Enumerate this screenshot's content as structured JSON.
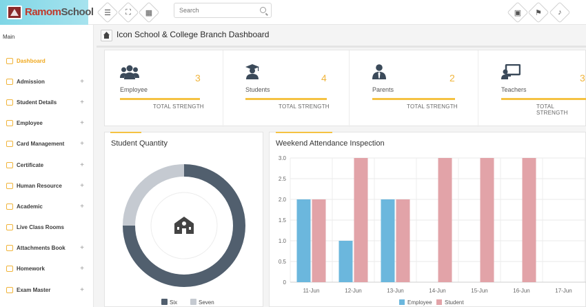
{
  "app": {
    "logo_part1": "Ramom",
    "logo_part2": "School"
  },
  "topbar": {
    "menu_icon": "hamburger-icon",
    "fullscreen_icon": "fullscreen-icon",
    "apps_icon": "grid-icon",
    "search": {
      "placeholder": "Search"
    },
    "right_icons": [
      "calendar-icon",
      "flag-icon",
      "bell-icon"
    ]
  },
  "sidebar": {
    "section_title": "Main",
    "items": [
      {
        "label": "Dashboard",
        "active": true,
        "expandable": false
      },
      {
        "label": "Admission",
        "expandable": true
      },
      {
        "label": "Student Details",
        "expandable": true
      },
      {
        "label": "Employee",
        "expandable": true
      },
      {
        "label": "Card Management",
        "expandable": true
      },
      {
        "label": "Certificate",
        "expandable": true
      },
      {
        "label": "Human Resource",
        "expandable": true
      },
      {
        "label": "Academic",
        "expandable": true
      },
      {
        "label": "Live Class Rooms",
        "expandable": false
      },
      {
        "label": "Attachments Book",
        "expandable": true
      },
      {
        "label": "Homework",
        "expandable": true
      },
      {
        "label": "Exam Master",
        "expandable": true
      }
    ],
    "plus": "+"
  },
  "page": {
    "title": "Icon School & College Branch Dashboard"
  },
  "stats": [
    {
      "label": "Employee",
      "count": "3",
      "sub": "TOTAL STRENGTH",
      "icon": "users-icon"
    },
    {
      "label": "Students",
      "count": "4",
      "sub": "TOTAL STRENGTH",
      "icon": "graduate-icon"
    },
    {
      "label": "Parents",
      "count": "2",
      "sub": "TOTAL STRENGTH",
      "icon": "user-tie-icon"
    },
    {
      "label": "Teachers",
      "count": "3",
      "sub": "TOTAL STRENGTH",
      "icon": "teacher-board-icon"
    }
  ],
  "colors": {
    "accent": "#f5c242",
    "donut_six": "#515f6e",
    "donut_seven": "#c5cad1",
    "employee_bar": "#6bb7dd",
    "student_bar": "#e2a3a8"
  },
  "chart_data": [
    {
      "type": "pie",
      "title": "Student Quantity",
      "labels": [
        "Six",
        "Seven"
      ],
      "values": [
        3,
        1
      ],
      "donut": true,
      "center_icon": "school-icon",
      "legend": "bottom"
    },
    {
      "type": "bar",
      "title": "Weekend Attendance Inspection",
      "categories": [
        "11-Jun",
        "12-Jun",
        "13-Jun",
        "14-Jun",
        "15-Jun",
        "16-Jun",
        "17-Jun"
      ],
      "series": [
        {
          "name": "Employee",
          "values": [
            2,
            1,
            2,
            0,
            0,
            0,
            0
          ]
        },
        {
          "name": "Student",
          "values": [
            2,
            3,
            2,
            3,
            3,
            3,
            0
          ]
        }
      ],
      "ylim": [
        0,
        3
      ],
      "yticks": [
        "0",
        "0.5",
        "1.0",
        "1.5",
        "2.0",
        "2.5",
        "3.0"
      ],
      "grid": true,
      "legend": "bottom"
    }
  ]
}
